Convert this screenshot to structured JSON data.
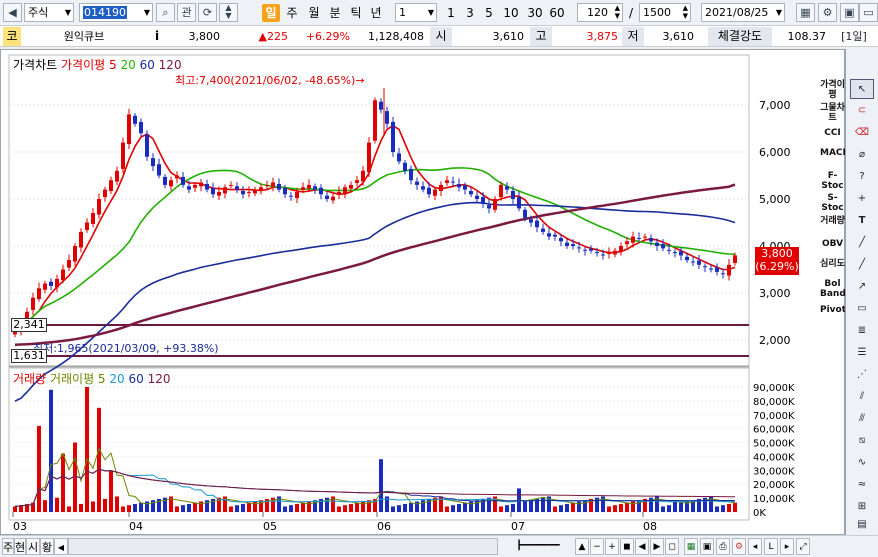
{
  "toolbar": {
    "market": "주식",
    "code": "014190",
    "kwan": "관",
    "periods": [
      "일",
      "주",
      "월",
      "분",
      "틱",
      "년"
    ],
    "interval_select": "1",
    "minute_buttons": [
      "1",
      "3",
      "5",
      "10",
      "30",
      "60"
    ],
    "count": "120",
    "count_sep": "/",
    "count_total": "1500",
    "date": "2021/08/25"
  },
  "info": {
    "code_label": "코",
    "name": "원익큐브",
    "info_icon": "i",
    "price": "3,800",
    "change": "▲225",
    "change_pct": "+6.29%",
    "volume": "1,128,408",
    "open_label": "시",
    "open": "3,610",
    "high_label": "고",
    "high": "3,875",
    "low_label": "저",
    "low": "3,610",
    "strength_label": "체결강도",
    "strength": "108.37",
    "period_tag": "[1일]"
  },
  "price_panel": {
    "legend": [
      "가격차트",
      "가격이평 5",
      "20",
      "60",
      "120"
    ],
    "legend_colors": [
      "#000000",
      "#e00000",
      "#22b000",
      "#1a2c9a",
      "#7a1a40"
    ],
    "max_note": "최고:7,400(2021/06/02, -48.65%)→",
    "min_note": "최저:1,965(2021/03/09, +93.38%)",
    "axis_ticks": [
      "7,000",
      "6,000",
      "5,000",
      "4,000",
      "3,000",
      "2,000"
    ],
    "current_price_tag": "3,800",
    "current_pct_tag": "(6.29%)",
    "hline1": "2,341",
    "hline2": "1,631"
  },
  "volume_panel": {
    "legend": [
      "거래량",
      "거래이평 5",
      "20",
      "60",
      "120"
    ],
    "legend_colors": [
      "#e00000",
      "#6a8a00",
      "#1a9ad0",
      "#1a2c9a",
      "#7a1a40"
    ],
    "axis_ticks": [
      "90,000K",
      "80,000K",
      "70,000K",
      "60,000K",
      "50,000K",
      "40,000K",
      "30,000K",
      "20,000K",
      "10,000K",
      "0K"
    ]
  },
  "x_axis": [
    "03",
    "04",
    "05",
    "06",
    "07",
    "08"
  ],
  "indicators": [
    "가격이평",
    "그물차트",
    "CCI",
    "MACD",
    "F-Stoc",
    "S-Stoc",
    "거래량",
    "OBV",
    "심리도",
    "Bol Band",
    "Pivot"
  ],
  "bottom": {
    "tabs": [
      "주",
      "현",
      "시",
      "황"
    ],
    "icons": [
      "zoom-out-icon",
      "zoom-in-icon",
      "fit-icon",
      "first-icon",
      "prev-icon",
      "next-icon",
      "last-icon"
    ]
  },
  "chart_data": {
    "type": "candlestick",
    "title": "",
    "x_labels": [
      "03",
      "04",
      "05",
      "06",
      "07",
      "08"
    ],
    "ylim": [
      1600,
      7500
    ],
    "prices_approx": [
      2341,
      2600,
      3100,
      3500,
      4200,
      5100,
      6000,
      6800,
      5800,
      5400,
      5300,
      5200,
      5100,
      5200,
      5300,
      5200,
      5100,
      5300,
      7200,
      6500,
      5600,
      5200,
      5300,
      5100,
      4900,
      4700,
      4400,
      4200,
      4000,
      4000,
      3900,
      4200,
      4100,
      3900,
      3700,
      3600,
      3500,
      3800
    ],
    "volume_max": 90000,
    "ma_periods": [
      5,
      20,
      60,
      120
    ]
  }
}
